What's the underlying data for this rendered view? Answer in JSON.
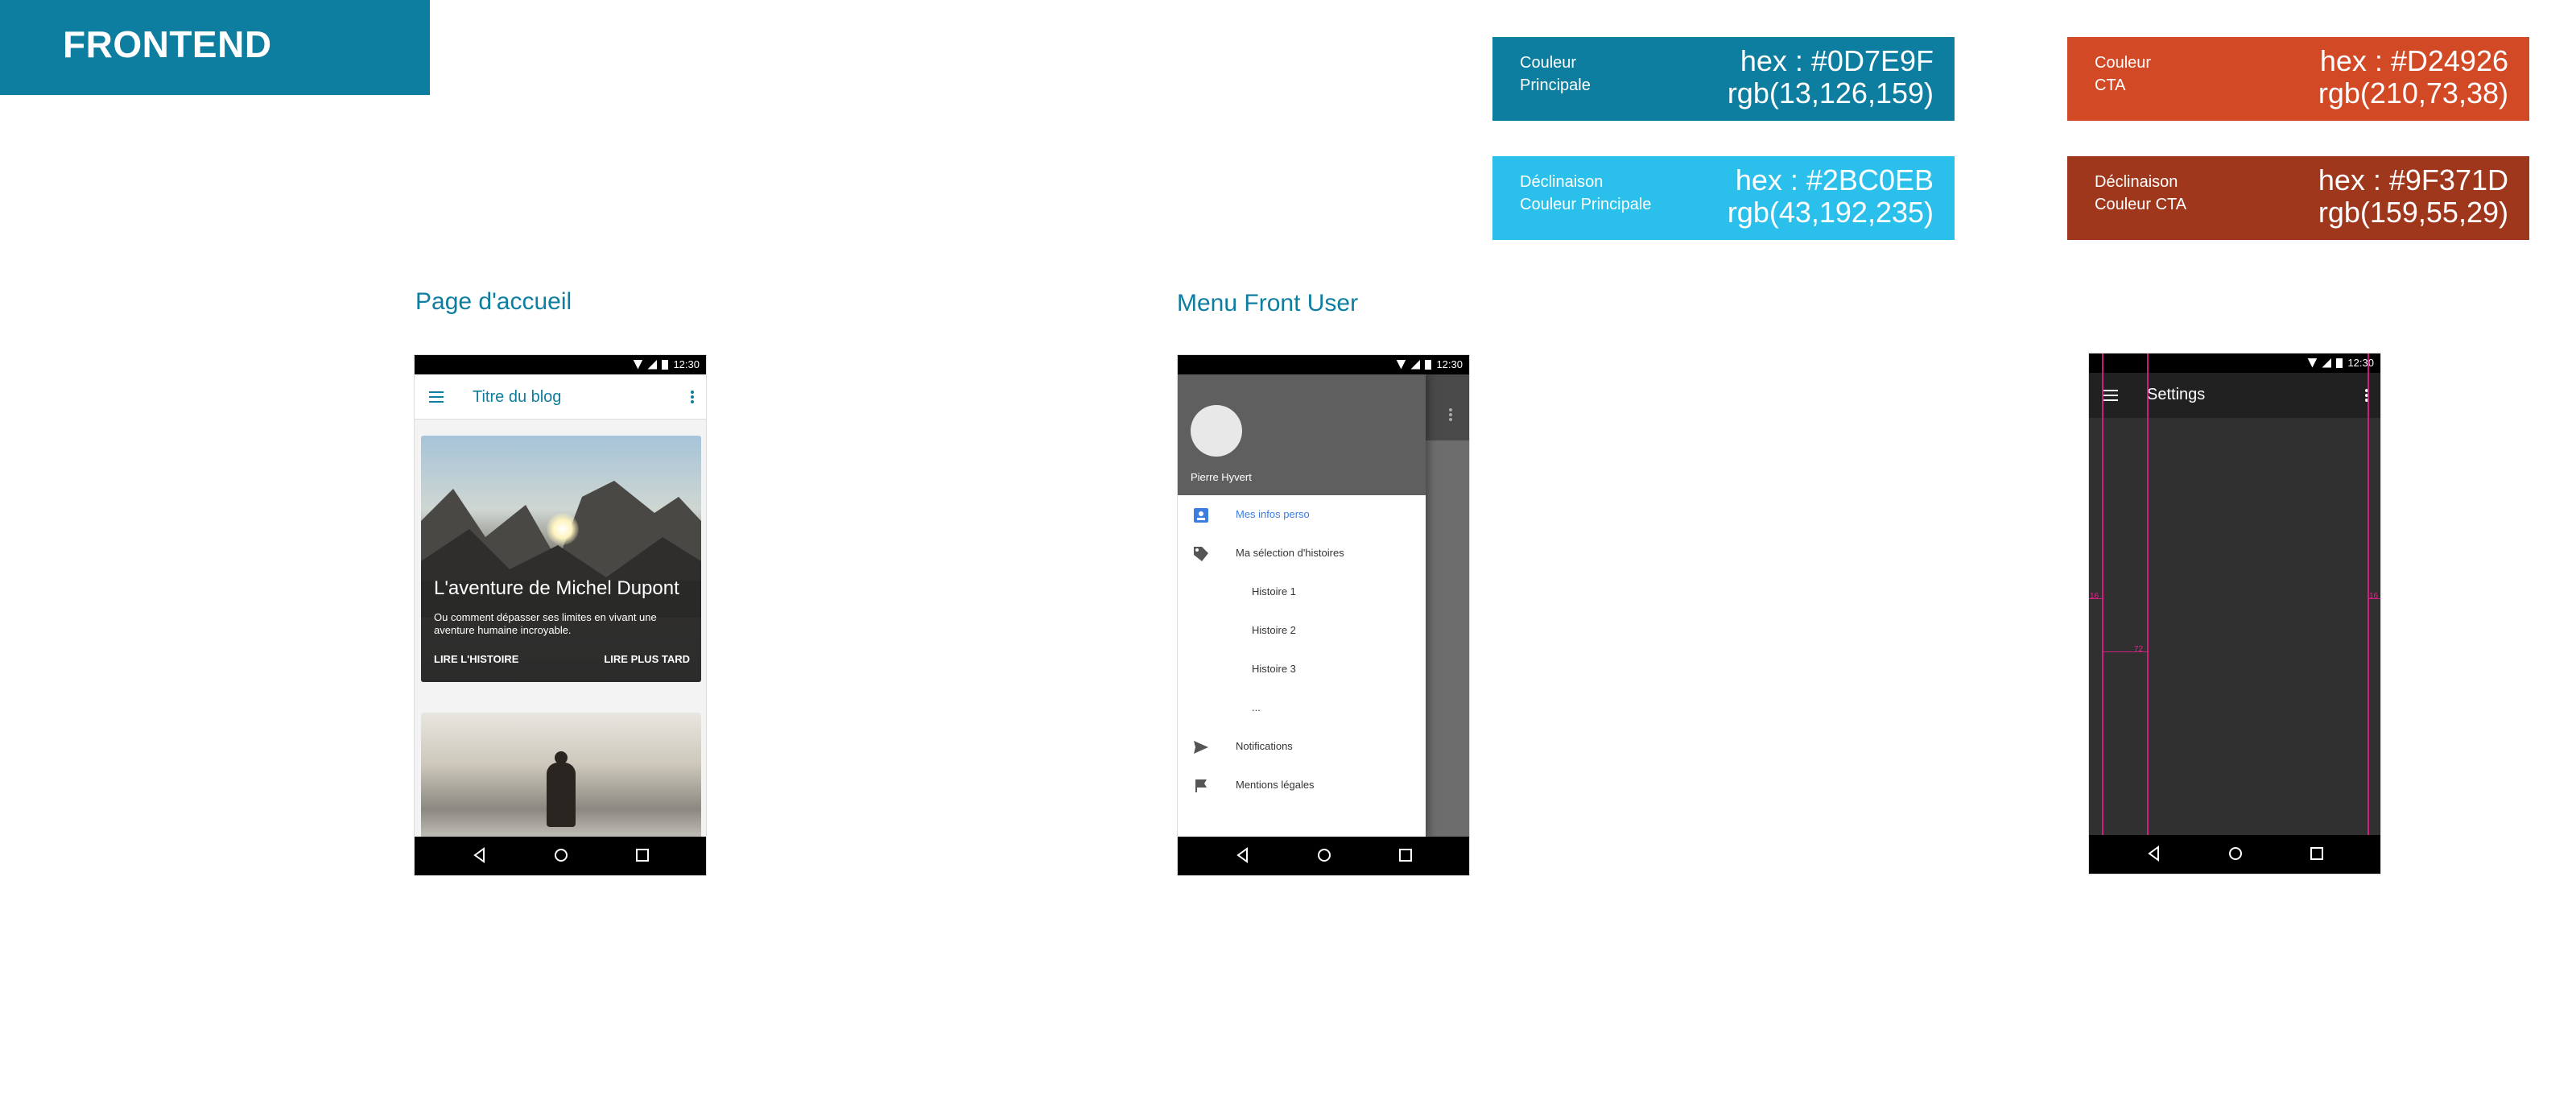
{
  "banner": {
    "title": "FRONTEND"
  },
  "colors": {
    "primary": {
      "label_line1": "Couleur",
      "label_line2": "Principale",
      "hex_text": "hex : #0D7E9F",
      "rgb_text": "rgb(13,126,159)",
      "swatch": "#0D7E9F"
    },
    "primary_variant": {
      "label_line1": "Déclinaison",
      "label_line2": "Couleur Principale",
      "hex_text": "hex : #2BC0EB",
      "rgb_text": "rgb(43,192,235)",
      "swatch": "#2BC0EB"
    },
    "cta": {
      "label_line1": "Couleur",
      "label_line2": "CTA",
      "hex_text": "hex : #D24926",
      "rgb_text": "rgb(210,73,38)",
      "swatch": "#D24926"
    },
    "cta_variant": {
      "label_line1": "Déclinaison",
      "label_line2": "Couleur CTA",
      "hex_text": "hex : #9F371D",
      "rgb_text": "rgb(159,55,29)",
      "swatch": "#9F371D"
    }
  },
  "sections": {
    "home": "Page d'accueil",
    "menu": "Menu Front User"
  },
  "status": {
    "time": "12:30"
  },
  "home_screen": {
    "app_title": "Titre du blog",
    "card1": {
      "title": "L'aventure de Michel Dupont",
      "subtitle": "Ou comment dépasser ses limites  en vivant une aventure humaine incroyable.",
      "primary_action": "LIRE L'HISTOIRE",
      "secondary_action": "LIRE PLUS TARD"
    }
  },
  "menu_screen": {
    "user_name": "Pierre Hyvert",
    "items": [
      {
        "label": "Mes infos perso",
        "icon": "account-box-icon"
      },
      {
        "label": "Ma sélection d'histoires",
        "icon": "tag-icon"
      },
      {
        "label": "Histoire 1",
        "icon": ""
      },
      {
        "label": "Histoire 2",
        "icon": ""
      },
      {
        "label": "Histoire 3",
        "icon": ""
      },
      {
        "label": "...",
        "icon": ""
      },
      {
        "label": "Notifications",
        "icon": "send-icon"
      },
      {
        "label": "Mentions légales",
        "icon": "flag-icon"
      }
    ]
  },
  "settings_screen": {
    "title": "Settings",
    "guide_labels": [
      "16",
      "16",
      "72"
    ]
  }
}
